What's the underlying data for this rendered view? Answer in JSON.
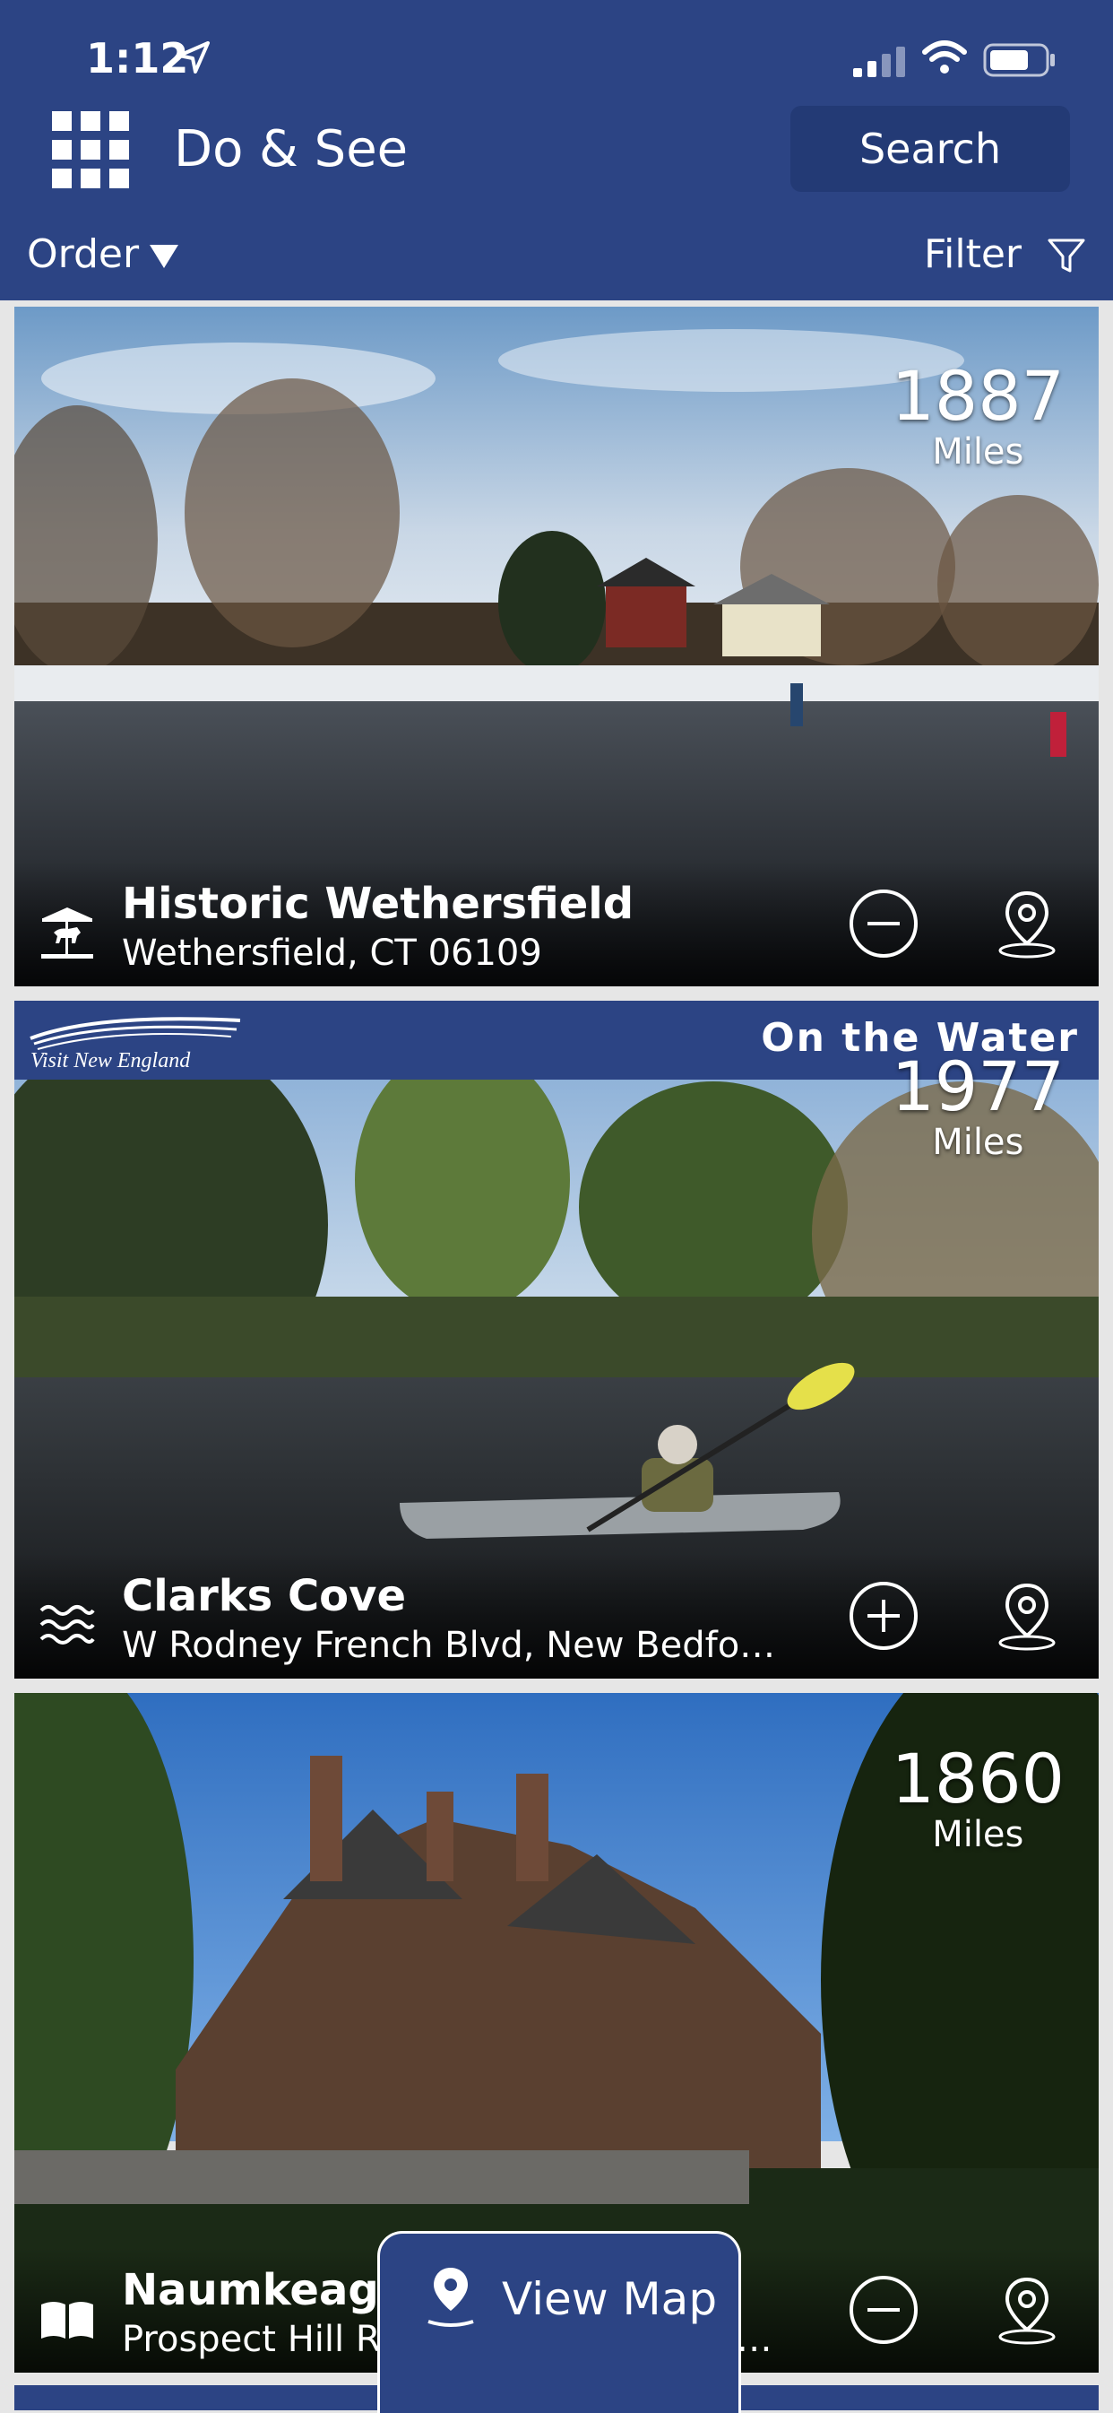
{
  "status": {
    "time": "1:12"
  },
  "app": {
    "title": "Do & See",
    "search_label": "Search"
  },
  "subbar": {
    "order_label": "Order",
    "filter_label": "Filter"
  },
  "cards": [
    {
      "name": "Historic Wethersfield",
      "address": "Wethersfield, CT 06109",
      "distance": "1887",
      "unit": "Miles",
      "category_icon": "carousel-horse-icon",
      "action_icon": "minus-circle-icon"
    },
    {
      "name": "Clarks Cove",
      "address": "W Rodney French Blvd, New Bedfor...",
      "distance": "1977",
      "unit": "Miles",
      "category_icon": "water-waves-icon",
      "action_icon": "plus-circle-icon",
      "banner_brand": "Visit New England",
      "banner_category": "On the Water"
    },
    {
      "name": "Naumkeag",
      "address": "Prospect Hill Road, Stockbridge, MA 01...",
      "distance": "1860",
      "unit": "Miles",
      "category_icon": "open-book-icon",
      "action_icon": "minus-circle-icon"
    }
  ],
  "view_map_label": "View Map",
  "colors": {
    "primary": "#2c4484",
    "primary_dark": "#233a75"
  }
}
